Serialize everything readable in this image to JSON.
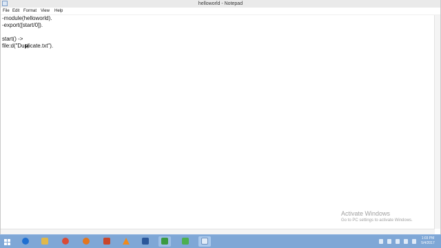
{
  "window": {
    "title": "helloworld - Notepad"
  },
  "menu": {
    "file": "File",
    "edit": "Edit",
    "format": "Format",
    "view": "View",
    "help": "Help"
  },
  "editor": {
    "lines": [
      "-module(helloworld).",
      "-export([start/0]).",
      "",
      "start() ->",
      "file:d(\"Duplicate.txt\")."
    ]
  },
  "watermark": {
    "title": "Activate Windows",
    "subtitle": "Go to PC settings to activate Windows."
  },
  "taskbar": {
    "apps": [
      {
        "icon": "internet-explorer-icon",
        "color": "#1f6fd1"
      },
      {
        "icon": "file-explorer-icon",
        "color": "#e0b84b"
      },
      {
        "icon": "chrome-icon",
        "color": "#d94b36"
      },
      {
        "icon": "firefox-icon",
        "color": "#e3761f"
      },
      {
        "icon": "powerpoint-icon",
        "color": "#c8452b"
      },
      {
        "icon": "vlc-icon",
        "color": "#f08a1c"
      },
      {
        "icon": "word-icon",
        "color": "#2b579a"
      },
      {
        "icon": "camtasia-icon",
        "color": "#3a9a42"
      },
      {
        "icon": "camtasia-recorder-icon",
        "color": "#4caf50"
      },
      {
        "icon": "notepad-icon",
        "color": "#9fc3e6"
      }
    ],
    "clock": {
      "time": "1:03 PM",
      "date": "5/4/2017"
    }
  }
}
